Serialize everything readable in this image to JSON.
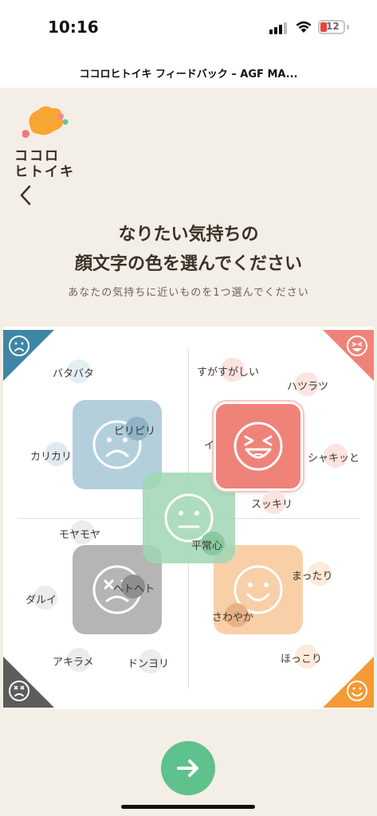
{
  "status": {
    "time": "10:16",
    "battery": "12"
  },
  "browser": {
    "title": "ココロヒトイキ フィードバック – AGF MA..."
  },
  "logo": {
    "line1": "ココロ",
    "line2": "ヒトイキ"
  },
  "nav": {
    "back": "<"
  },
  "heading": {
    "line1": "なりたい気持ちの",
    "line2": "顔文字の色を選んでください"
  },
  "subtitle": "あなたの気持ちに近いものを1つ選んでください",
  "colors": {
    "sad": "#a6c7d6",
    "happy": "#ef837a",
    "neutral": "#9fd8b3",
    "dizzy": "#a9a9a9",
    "smile": "#f8c79a",
    "accent": "#5fc18d",
    "corner_sad": "#3f86a6",
    "corner_happy": "#ef837a",
    "corner_dizzy": "#5c5c5c",
    "corner_smile": "#f39a35"
  },
  "words": {
    "batabata": "バタバタ",
    "piripiri": "ピリピリ",
    "karikari": "カリカリ",
    "mosomoya": "モヤモヤ",
    "darui": "ダルイ",
    "hetoheto": "ヘトヘト",
    "akirame": "アキラメ",
    "donyori": "ドンヨリ",
    "sugasugashii": "すがすがしい",
    "haturatu": "ハツラツ",
    "i": "イ",
    "shakitto": "シャキッと",
    "sukkiri": "スッキリ",
    "heijoushin": "平常心",
    "mattari": "まったり",
    "sawayaka": "さわやか",
    "hokkori": "ほっこり"
  },
  "icons": {
    "next": "arrow-right-icon",
    "sad": "sad-face-icon",
    "happy": "laughing-face-icon",
    "neutral": "neutral-face-icon",
    "dizzy": "dizzy-face-icon",
    "smile": "smile-face-icon"
  }
}
